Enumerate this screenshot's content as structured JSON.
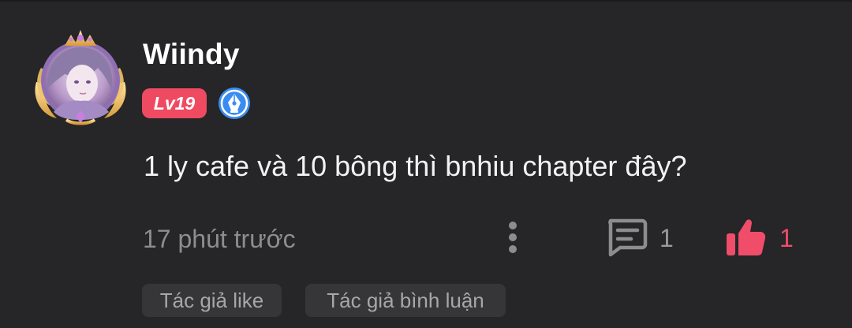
{
  "comment": {
    "username": "Wiindy",
    "level_badge": "Lv19",
    "text": "1 ly cafe và 10 bông thì bnhiu chapter đây?",
    "timestamp": "17 phút trước",
    "reply_count": "1",
    "like_count": "1",
    "tags": [
      "Tác giả like",
      "Tác giả bình luận"
    ]
  },
  "icons": {
    "avatar": "avatar-with-gold-frame",
    "badge": "pen-nib-icon",
    "more": "more-vertical-icon",
    "reply": "comment-icon",
    "like": "thumbs-up-icon"
  },
  "colors": {
    "background": "#262527",
    "level_badge": "#ee4b63",
    "like_accent": "#ef4d6a",
    "muted_text": "#8d8d8f",
    "tag_background": "#363538"
  }
}
